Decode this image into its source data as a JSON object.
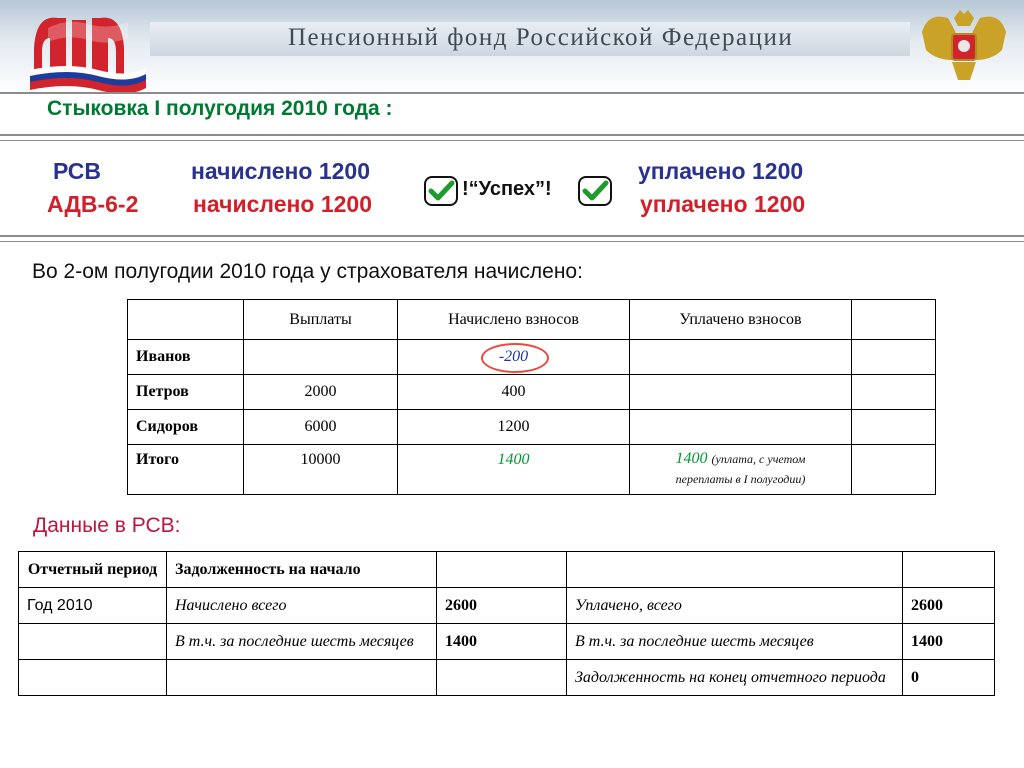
{
  "header": {
    "org_title": "Пенсионный фонд Российской Федерации"
  },
  "title": "Стыковка I полугодия 2010 года :",
  "rsv": {
    "label": "РСВ",
    "accrued": "начислено 1200",
    "paid": "уплачено 1200"
  },
  "adv": {
    "label": "АДВ-6-2",
    "accrued": "начислено 1200",
    "paid": "уплачено 1200"
  },
  "success_text": "!“Успех”!",
  "subtitle": "Во 2-ом полугодии 2010 года у страхователя начислено:",
  "table1": {
    "headers": [
      "",
      "Выплаты",
      "Начислено взносов",
      "Уплачено взносов",
      ""
    ],
    "rows": [
      {
        "name": "Иванов",
        "payments": "",
        "accrued": "-200",
        "paid": "",
        "extra": ""
      },
      {
        "name": "Петров",
        "payments": "2000",
        "accrued": "400",
        "paid": "",
        "extra": ""
      },
      {
        "name": "Сидоров",
        "payments": "6000",
        "accrued": "1200",
        "paid": "",
        "extra": ""
      }
    ],
    "total": {
      "name": "Итого",
      "payments": "10000",
      "accrued": "1400",
      "paid": "1400",
      "paid_note": "(уплата, с учетом",
      "paid_note2": "переплаты в I полугодии)"
    }
  },
  "subtitle2": "Данные в РСВ:",
  "table2": {
    "header": {
      "period": "Отчетный период",
      "debt": "Задолженность на начало"
    },
    "rows": [
      {
        "c1": "Год 2010",
        "c2": "Начислено всего",
        "c3": "2600",
        "c4": "Уплачено, всего",
        "c5": "2600"
      },
      {
        "c1": "",
        "c2": "В т.ч. за последние шесть месяцев",
        "c3": "1400",
        "c4": "В т.ч. за последние шесть месяцев",
        "c5": "1400"
      },
      {
        "c1": "",
        "c2": "",
        "c3": "",
        "c4": "Задолженность на конец отчетного периода",
        "c5": "0"
      }
    ]
  },
  "colors": {
    "title_green": "#007a33",
    "blue": "#29338f",
    "red": "#d21f2a",
    "check_green": "#1e9b2c",
    "ellipse": "#e84a3c",
    "subtitle2": "#c0143c"
  }
}
